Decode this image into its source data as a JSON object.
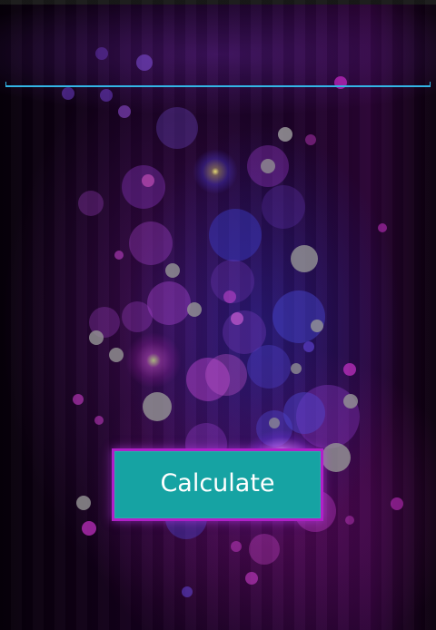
{
  "input": {
    "value": "",
    "placeholder": ""
  },
  "button": {
    "label": "Calculate"
  },
  "colors": {
    "underline": "#33b5e5",
    "button_fill": "#16a3a3",
    "button_border": "#b020c8",
    "background_primary": "#1a0226"
  }
}
